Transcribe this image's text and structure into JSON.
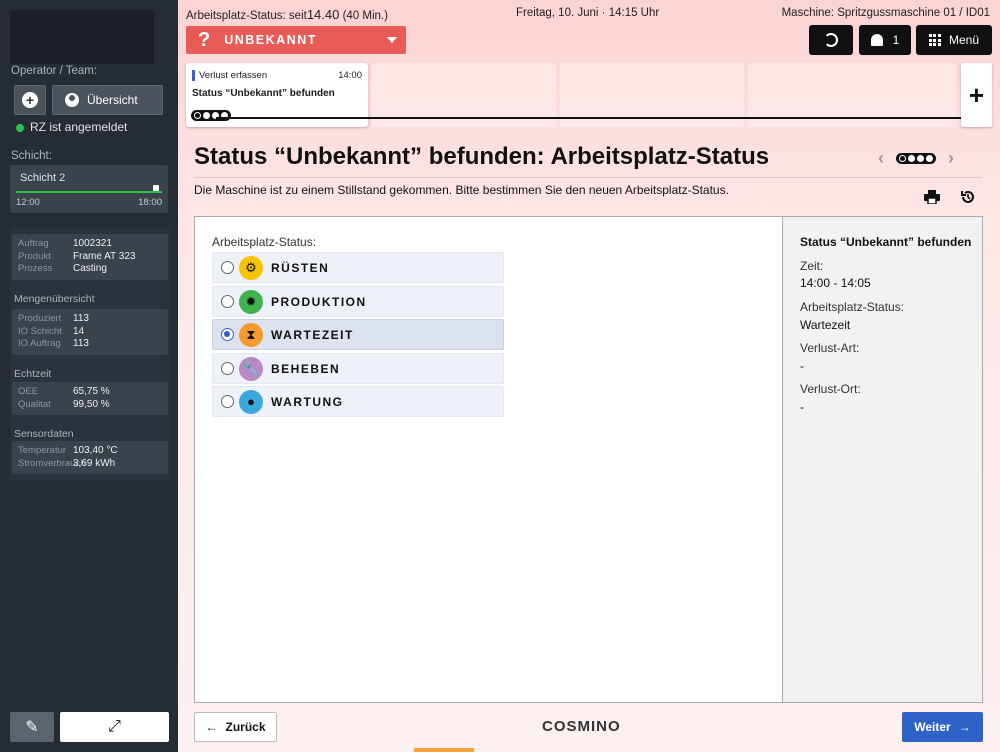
{
  "sidebar": {
    "operator_label": "Operator / Team:",
    "overview_button": "Übersicht",
    "login_status": "RZ ist angemeldet",
    "shift_label": "Schicht:",
    "shift": {
      "name": "Schicht 2",
      "start": "12:00",
      "end": "18:00",
      "progress": 0.98
    },
    "order": [
      {
        "k": "Auftrag",
        "v": "1002321"
      },
      {
        "k": "Produkt",
        "v": "Frame AT 323"
      },
      {
        "k": "Prozess",
        "v": "Casting"
      }
    ],
    "quantity_title": "Mengenübersicht",
    "quantity": [
      {
        "k": "Produziert",
        "v": "113"
      },
      {
        "k": "IO Schicht",
        "v": "14"
      },
      {
        "k": "IO Auftrag",
        "v": "113"
      }
    ],
    "realtime_title": "Echtzeit",
    "realtime": [
      {
        "k": "OEE",
        "v": "65,75 %"
      },
      {
        "k": "Qualitat",
        "v": "99,50 %"
      }
    ],
    "sensor_title": "Sensordaten",
    "sensor": [
      {
        "k": "Temperatur",
        "v": "103,40 °C"
      },
      {
        "k": "Stromverbrauch",
        "v": "3,69 kWh"
      }
    ]
  },
  "header": {
    "status_label": "Arbeitsplatz-Status:",
    "status_since_prefix": "seit",
    "status_since_time": "14.40",
    "status_since_duration": "(40 Min.)",
    "date": "Freitag, 10. Juni",
    "time": "14:15 Uhr",
    "machine_label": "Maschine:",
    "machine_value": "Spritzgussmaschine 01 / ID01",
    "status_button": "UNBEKANNT",
    "bell_count": "1",
    "menu_label": "Menü"
  },
  "timeline": {
    "card_title": "Verlust erfassen",
    "card_time": "14:00",
    "card_sub": "Status “Unbekannt” befunden"
  },
  "page": {
    "title": "Status “Unbekannt” befunden: Arbeitsplatz-Status",
    "description": "Die Maschine ist zu einem Stillstand gekommen. Bitte bestimmen Sie den neuen Arbeitsplatz-Status.",
    "options_label": "Arbeitsplatz-Status:",
    "options": [
      {
        "label": "RÜSTEN",
        "icon": "setup-icon",
        "color": "#f5c400",
        "selected": false
      },
      {
        "label": "PRODUKTION",
        "icon": "gear-icon",
        "color": "#3fb34f",
        "selected": false
      },
      {
        "label": "WARTEZEIT",
        "icon": "hourglass-icon",
        "color": "#f29a2e",
        "selected": true
      },
      {
        "label": "BEHEBEN",
        "icon": "wrench-icon",
        "color": "#b889c4",
        "selected": false
      },
      {
        "label": "WARTUNG",
        "icon": "drop-icon",
        "color": "#3aa7de",
        "selected": false
      }
    ]
  },
  "summary": {
    "title": "Status “Unbekannt” befunden",
    "zeit_label": "Zeit:",
    "zeit_value": "14:00 - 14:05",
    "status_label": "Arbeitsplatz-Status:",
    "status_value": "Wartezeit",
    "verlust_art_label": "Verlust-Art:",
    "verlust_art_value": "-",
    "verlust_ort_label": "Verlust-Ort:",
    "verlust_ort_value": "-"
  },
  "footer": {
    "back_label": "Zurück",
    "brand": "COSMINO",
    "next_label": "Weiter"
  },
  "colors": {
    "accent": "#2f62c6",
    "status_unknown": "#e85b57",
    "sidebar_bg": "#252c34",
    "logged_in": "#2fbf4f"
  }
}
